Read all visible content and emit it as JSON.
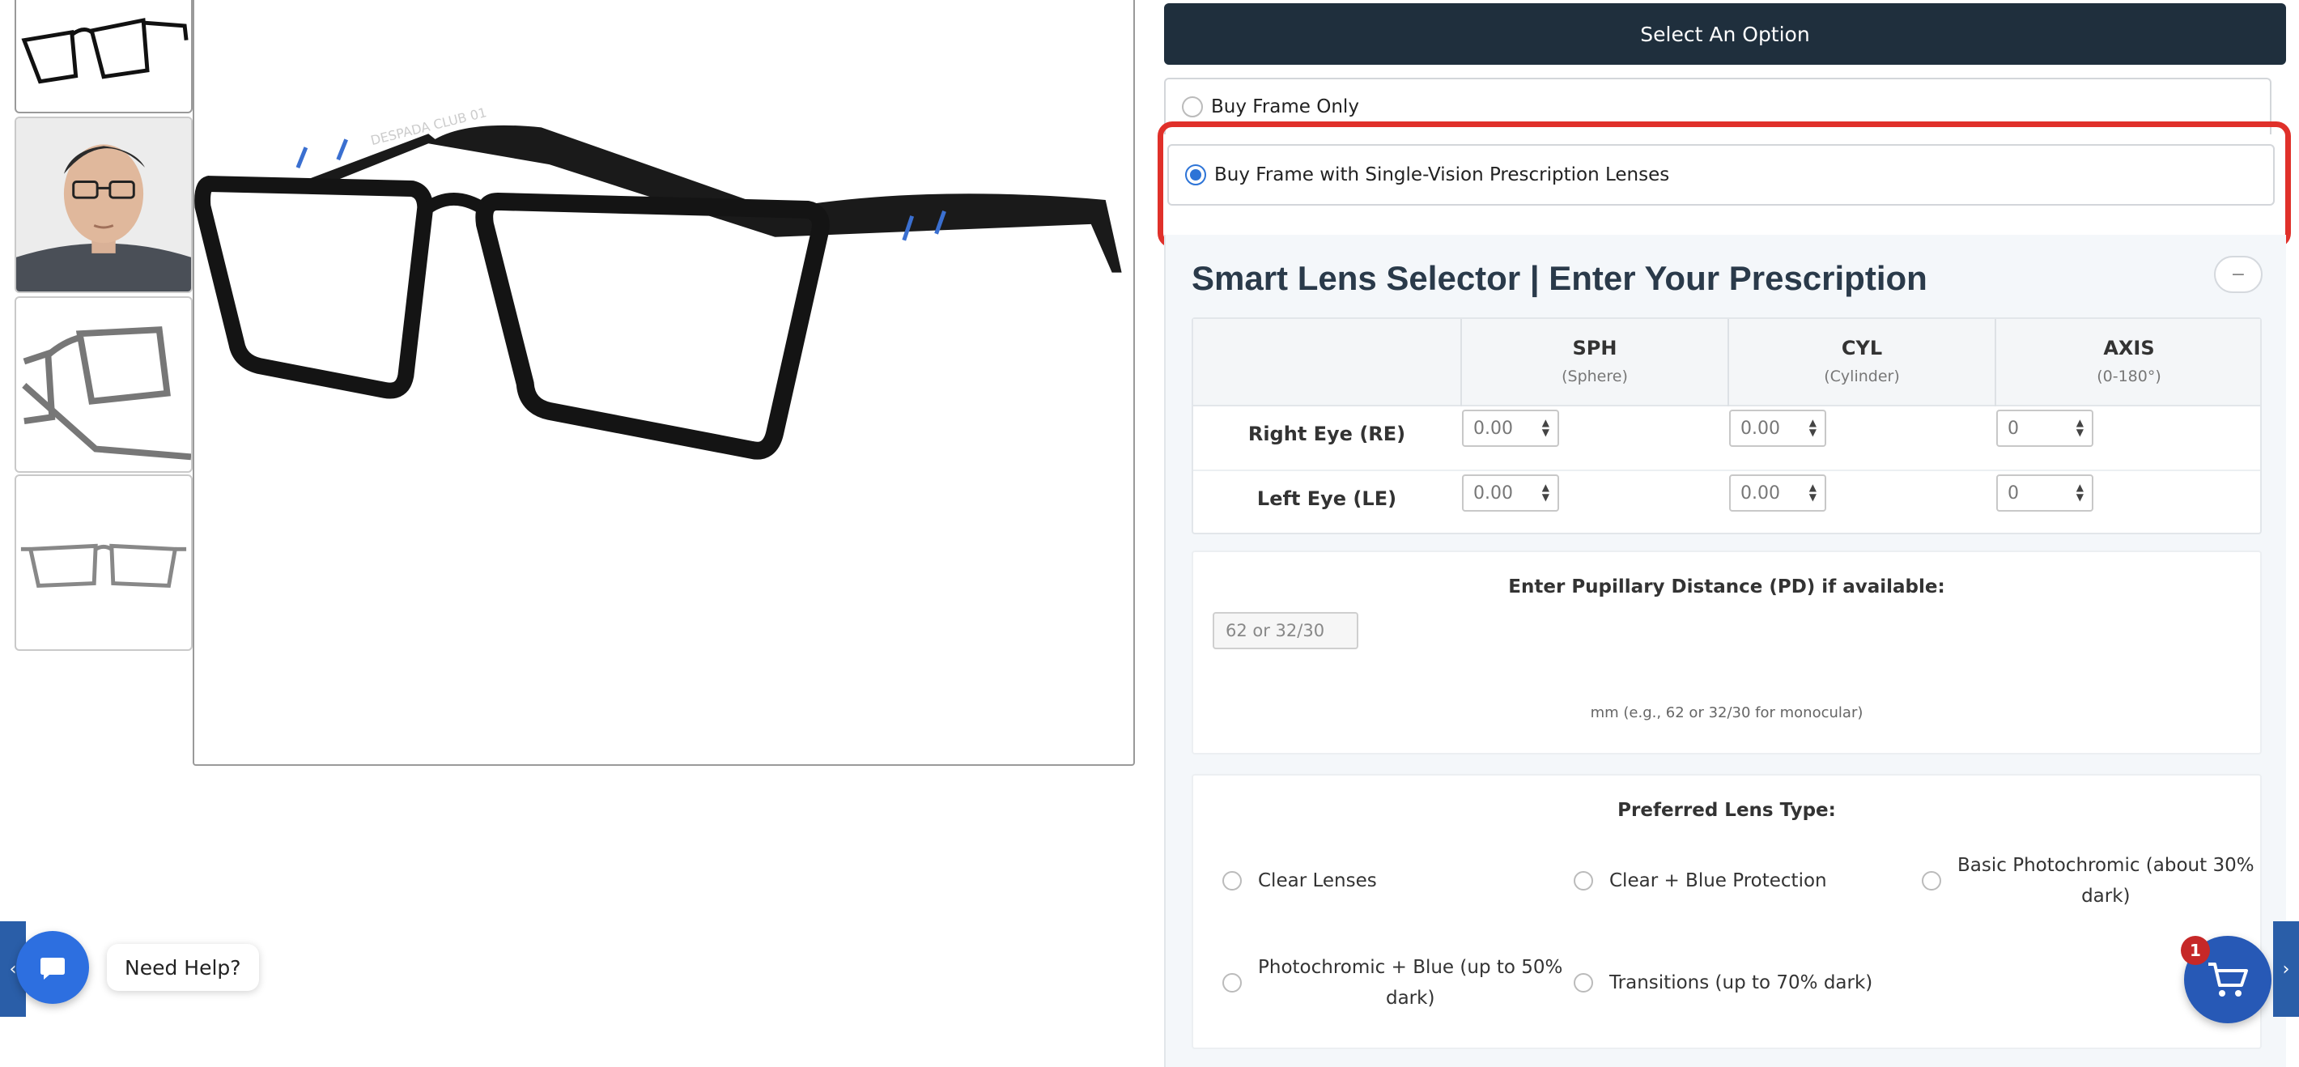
{
  "product_options": {
    "header": "Select An Option",
    "options": [
      {
        "label": "Buy Frame Only",
        "selected": false
      },
      {
        "label": "Buy Frame with Single-Vision Prescription Lenses",
        "selected": true
      }
    ]
  },
  "lens_selector": {
    "title": "Smart Lens Selector | Enter Your Prescription",
    "collapse_symbol": "−",
    "columns": [
      {
        "label": "SPH",
        "sub": "(Sphere)"
      },
      {
        "label": "CYL",
        "sub": "(Cylinder)"
      },
      {
        "label": "AXIS",
        "sub": "(0-180°)"
      }
    ],
    "rows": [
      {
        "label": "Right Eye (RE)",
        "sph": "0.00",
        "cyl": "0.00",
        "axis": "0"
      },
      {
        "label": "Left Eye (LE)",
        "sph": "0.00",
        "cyl": "0.00",
        "axis": "0"
      }
    ],
    "pd": {
      "title": "Enter Pupillary Distance (PD) if available:",
      "placeholder": "62 or 32/30",
      "note": "mm (e.g., 62 or 32/30 for monocular)"
    },
    "lens_type": {
      "title": "Preferred Lens Type:",
      "options": [
        {
          "line1": "Clear Lenses",
          "line2": ""
        },
        {
          "line1": "Clear + Blue Protection",
          "line2": ""
        },
        {
          "line1": "Basic Photochromic (about 30%",
          "line2": "dark)"
        },
        {
          "line1": "Photochromic + Blue (up to 50%",
          "line2": "dark)"
        },
        {
          "line1": "Transitions (up to 70% dark)",
          "line2": ""
        }
      ]
    }
  },
  "widgets": {
    "help_label": "Need Help?",
    "cart_count": "1",
    "left_arrow": "‹",
    "right_arrow": "›"
  },
  "gallery": {
    "frame_brand_text": "DESPADA CLUB 01"
  },
  "colors": {
    "header_bg": "#1f2f3d",
    "highlight": "#e0302a",
    "radio_selected": "#2d74d7",
    "help_button": "#2d6fe0",
    "cart_button": "#2759b6",
    "cart_badge": "#c62828"
  }
}
